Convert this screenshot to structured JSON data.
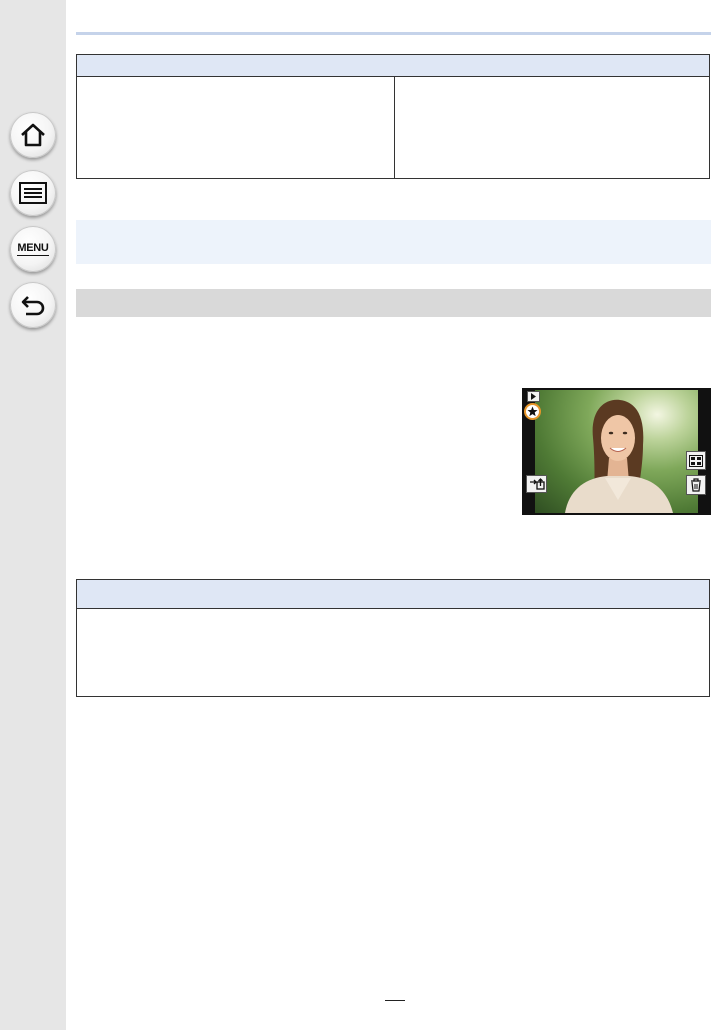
{
  "sidebar": {
    "items": [
      {
        "id": "home",
        "icon": "home-icon"
      },
      {
        "id": "contents",
        "icon": "list-icon"
      },
      {
        "id": "menu",
        "icon": "menu-icon",
        "label": "MENU"
      },
      {
        "id": "back",
        "icon": "back-arrow-icon"
      }
    ]
  },
  "screen": {
    "icons": [
      "playback-icon",
      "favorite-star-icon",
      "grid-icon",
      "upload-icon",
      "delete-icon"
    ]
  },
  "colors": {
    "header_blue": "#dfe7f5",
    "note_blue": "#edf3fb",
    "section_gray": "#d9d9d9",
    "sidebar_gray": "#e6e6e6",
    "highlight_orange": "#e8962a"
  }
}
